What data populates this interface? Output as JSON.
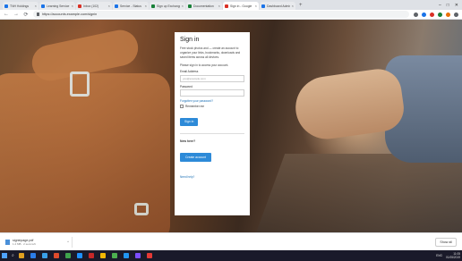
{
  "browser": {
    "tabs": [
      {
        "label": "TNH Holdings",
        "color": "#1a73e8",
        "active": false
      },
      {
        "label": "Learning Service",
        "color": "#1a73e8",
        "active": false
      },
      {
        "label": "Inbox (102)",
        "color": "#d93025",
        "active": false
      },
      {
        "label": "Service - Status",
        "color": "#1a73e8",
        "active": false
      },
      {
        "label": "Sign up Exchange",
        "color": "#188038",
        "active": false
      },
      {
        "label": "Documentation",
        "color": "#188038",
        "active": false
      },
      {
        "label": "Sign in - Google",
        "color": "#d93025",
        "active": true
      },
      {
        "label": "Dashboard Admin",
        "color": "#1a73e8",
        "active": false
      }
    ],
    "new_tab": "+",
    "window_controls": {
      "minimize": "–",
      "maximize": "□",
      "close": "✕"
    },
    "address": "https://accounts.example.com/signin",
    "nav": {
      "back": "←",
      "forward": "→",
      "reload": "⟳"
    }
  },
  "signin": {
    "title": "Sign in",
    "description": "Free stock photos and — create an account to organize your links, bookmarks, downloads and saved items across all devices.",
    "instruction": "Please sign in to access your account.",
    "email_label": "Email Address",
    "email_placeholder": "you@example.com",
    "password_label": "Password",
    "password_placeholder": "",
    "forgot_link": "Forgotten your password?",
    "remember_label": "Remember me",
    "signin_button": "Sign in",
    "new_here": "New here?",
    "create_button": "Create account",
    "help_link": "Need help?"
  },
  "download": {
    "filename": "signinpage.pdf",
    "size": "1.2 MB · 2 secs left",
    "caret": "^",
    "show_all": "Show all"
  },
  "taskbar": {
    "search_glyph": "⌕",
    "icon_colors": [
      "#e0a020",
      "#2b7de9",
      "#3aa0e8",
      "#e04b2c",
      "#3fa34d",
      "#1e90ff",
      "#c62828",
      "#f2b705",
      "#4caf50",
      "#2196f3",
      "#7c4dff",
      "#e53935"
    ],
    "tray_text": "ENG",
    "time": "11:05",
    "date": "01/05/2019"
  }
}
